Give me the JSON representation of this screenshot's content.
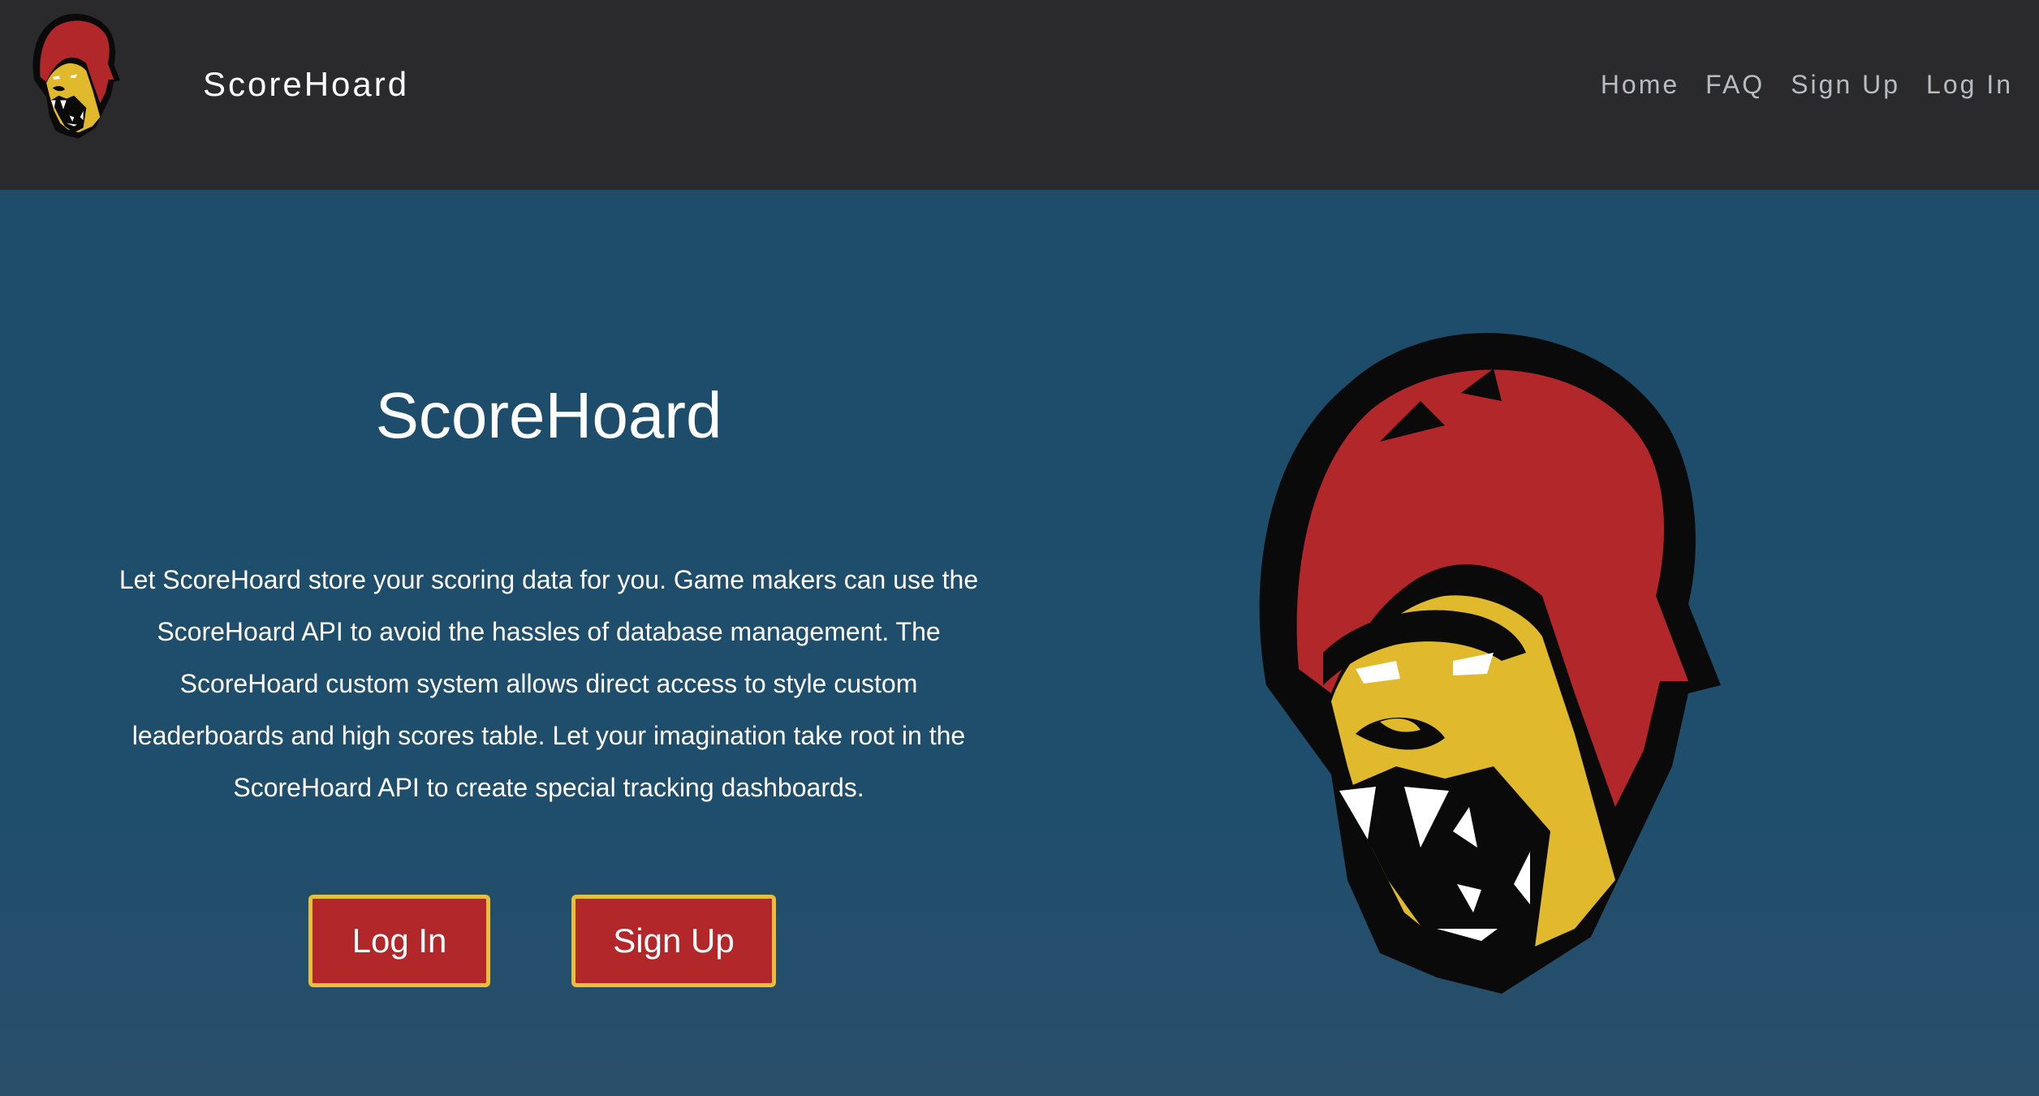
{
  "navbar": {
    "brand": "ScoreHoard",
    "links": [
      "Home",
      "FAQ",
      "Sign Up",
      "Log In"
    ]
  },
  "hero": {
    "title": "ScoreHoard",
    "description": "Let ScoreHoard store your scoring data for you. Game makers can use the ScoreHoard API to avoid the hassles of database management. The ScoreHoard custom system allows direct access to style custom leaderboards and high scores table. Let your imagination take root in the ScoreHoard API to create special tracking dashboards.",
    "login_label": "Log In",
    "signup_label": "Sign Up"
  },
  "icons": {
    "logo": "gorilla-logo-icon"
  },
  "colors": {
    "navbar_bg": "#2a2a2c",
    "hero_bg": "#1d4c6b",
    "button_bg": "#b1272a",
    "button_border": "#e8bf3a",
    "logo_red": "#b1272a",
    "logo_yellow": "#e0ba2c"
  }
}
